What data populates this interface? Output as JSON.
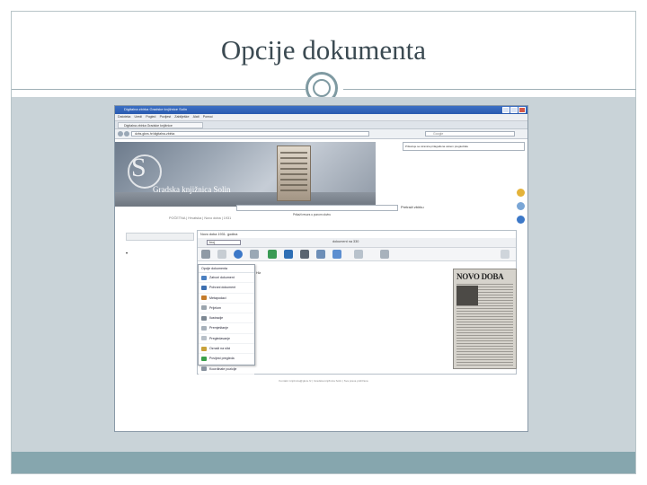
{
  "slide": {
    "title": "Opcije dokumenta"
  },
  "browser": {
    "window_title": "Digitalna zbirka Gradske knjižnice Solin",
    "menu_items": [
      "Datoteka",
      "Uredi",
      "Pogled",
      "Povijest",
      "Zabilješke",
      "Alati",
      "Pomoć"
    ],
    "tab_label": "Digitalna zbirka Gradske knjižnice",
    "url": "dzbs.gkns.hr/digitalna-zbirka",
    "search_placeholder": "Google",
    "banner_text": "Gradska knjižnica Solin",
    "redirect_text": "Prikazuje se stranica prilagođena vašem pregledniku",
    "search_button": "Pretraži zbirku",
    "crumbs": "POČETNA  |  Hrvatska  |  Novo doba  |  1931",
    "resource_link": "Prikaži resurs u punom okviru"
  },
  "viewer": {
    "header": "Novo doba 1931. godina",
    "select_value": "broj",
    "page_label": "dokument na 330",
    "fragment_text": "Hlz"
  },
  "menu": {
    "header": "Opcije dokumenta",
    "items": [
      {
        "label": "Zatvori dokument",
        "color": "#4a7fc1"
      },
      {
        "label": "Pohrani dokument",
        "color": "#3c6fb0"
      },
      {
        "label": "Metapodaci",
        "color": "#c47b2a"
      },
      {
        "label": "Prijelom",
        "color": "#9aa4ad"
      },
      {
        "label": "Ilustracije",
        "color": "#7d8893"
      },
      {
        "label": "Premještanje",
        "color": "#a6b0ba"
      },
      {
        "label": "Pregledavanje",
        "color": "#b8c0c8"
      },
      {
        "label": "Označi na slici",
        "color": "#c9a23a"
      },
      {
        "label": "Povijest pregleda",
        "color": "#3aa04a"
      },
      {
        "label": "Koordinate pozicije",
        "color": "#8a94a0"
      }
    ]
  },
  "newspaper": {
    "masthead": "NOVO DOBA"
  },
  "footnote": "Kontakt: knjiznica@gkns.hr | Gradska knjižnica Solin | Sva prava pridržana",
  "colors": {
    "accent": "#7f9aa2",
    "panel": "#c9d3d8",
    "footer": "#86a6ae"
  }
}
